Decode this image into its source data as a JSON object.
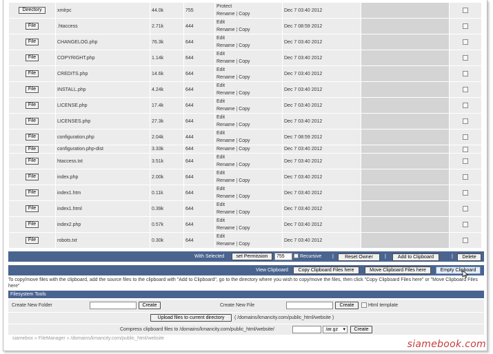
{
  "files": [
    {
      "type": "Directory",
      "name": "xmlrpc",
      "size": "44.0k",
      "perm": "755",
      "actions": [
        "Protect"
      ],
      "actions2": [
        "Rename",
        "Copy"
      ],
      "date": "Dec 7 03:40 2012"
    },
    {
      "type": "File",
      "name": ".htaccess",
      "size": "2.71k",
      "perm": "444",
      "actions": [
        "Edit"
      ],
      "actions2": [
        "Rename",
        "Copy"
      ],
      "date": "Dec 7 08:59 2012"
    },
    {
      "type": "File",
      "name": "CHANGELOG.php",
      "size": "76.3k",
      "perm": "644",
      "actions": [
        "Edit"
      ],
      "actions2": [
        "Rename",
        "Copy"
      ],
      "date": "Dec 7 03:40 2012"
    },
    {
      "type": "File",
      "name": "COPYRIGHT.php",
      "size": "1.14k",
      "perm": "644",
      "actions": [
        "Edit"
      ],
      "actions2": [
        "Rename",
        "Copy"
      ],
      "date": "Dec 7 03:40 2012"
    },
    {
      "type": "File",
      "name": "CREDITS.php",
      "size": "14.6k",
      "perm": "644",
      "actions": [
        "Edit"
      ],
      "actions2": [
        "Rename",
        "Copy"
      ],
      "date": "Dec 7 03:40 2012"
    },
    {
      "type": "File",
      "name": "INSTALL.php",
      "size": "4.24k",
      "perm": "644",
      "actions": [
        "Edit"
      ],
      "actions2": [
        "Rename",
        "Copy"
      ],
      "date": "Dec 7 03:40 2012"
    },
    {
      "type": "File",
      "name": "LICENSE.php",
      "size": "17.4k",
      "perm": "644",
      "actions": [
        "Edit"
      ],
      "actions2": [
        "Rename",
        "Copy"
      ],
      "date": "Dec 7 03:40 2012"
    },
    {
      "type": "File",
      "name": "LICENSES.php",
      "size": "27.3k",
      "perm": "644",
      "actions": [
        "Edit"
      ],
      "actions2": [
        "Rename",
        "Copy"
      ],
      "date": "Dec 7 03:40 2012"
    },
    {
      "type": "File",
      "name": "configuration.php",
      "size": "2.04k",
      "perm": "444",
      "actions": [
        "Edit"
      ],
      "actions2": [
        "Rename",
        "Copy"
      ],
      "date": "Dec 7 08:59 2012"
    },
    {
      "type": "File",
      "name": "configuration.php-dist",
      "size": "3.33k",
      "perm": "644",
      "actions": [],
      "actions2": [
        "Rename",
        "Copy"
      ],
      "date": "Dec 7 03:40 2012"
    },
    {
      "type": "File",
      "name": "htaccess.txt",
      "size": "3.51k",
      "perm": "644",
      "actions": [
        "Edit"
      ],
      "actions2": [
        "Rename",
        "Copy"
      ],
      "date": "Dec 7 03:40 2012"
    },
    {
      "type": "File",
      "name": "index.php",
      "size": "2.00k",
      "perm": "644",
      "actions": [
        "Edit"
      ],
      "actions2": [
        "Rename",
        "Copy"
      ],
      "date": "Dec 7 03:40 2012"
    },
    {
      "type": "File",
      "name": "index1.htm",
      "size": "0.11k",
      "perm": "644",
      "actions": [
        "Edit"
      ],
      "actions2": [
        "Rename",
        "Copy"
      ],
      "date": "Dec 7 03:40 2012"
    },
    {
      "type": "File",
      "name": "index1.html",
      "size": "0.39k",
      "perm": "644",
      "actions": [
        "Edit"
      ],
      "actions2": [
        "Rename",
        "Copy"
      ],
      "date": "Dec 7 03:40 2012"
    },
    {
      "type": "File",
      "name": "index2.php",
      "size": "0.57k",
      "perm": "644",
      "actions": [
        "Edit"
      ],
      "actions2": [
        "Rename",
        "Copy"
      ],
      "date": "Dec 7 03:40 2012"
    },
    {
      "type": "File",
      "name": "robots.txt",
      "size": "0.30k",
      "perm": "644",
      "actions": [
        "Edit"
      ],
      "actions2": [
        "Rename",
        "Copy"
      ],
      "date": "Dec 7 03:40 2012"
    }
  ],
  "with_selected": {
    "label": "With Selected",
    "set_permission": "set Permission",
    "permission_value": "755",
    "recursive": "Recursive",
    "reset_owner": "Reset Owner",
    "add_to_clipboard": "Add to Clipboard",
    "delete": "Delete",
    "pipe": "|"
  },
  "clipboard": {
    "view": "View Clipboard",
    "copy_here": "Copy Clipboard Files here",
    "move_here": "Move Clipboard Files here",
    "empty": "Empty Clipboard"
  },
  "help_text": "To copy/move files with the clipboard, add the source files to the clipboard with \"Add to Clipboard\", go to the directory where you wish to copy/move the files, then click \"Copy Clipboard Files here\" or \"Move Clipboard Files here\"",
  "filesystem_tools": {
    "title": "Filesystem Tools",
    "new_folder_label": "Create New Folder",
    "new_folder_button": "Create",
    "new_file_label": "Create New File",
    "new_file_button": "Create",
    "html_template": "Html template",
    "upload_button": "Upload files to current directory",
    "upload_path": "( /domains/kmancity.com/public_html/website )",
    "compress_label": "Compress clipboard files to /domains/kmancity.com/public_html/website/",
    "compress_ext": ".tar.gz",
    "compress_button": "Create"
  },
  "breadcrumb": "siamebox » FileManager » /domains/kmancity.com/public_html/website",
  "watermark": "siamebook.com",
  "colors": {
    "bar": "#4a6490",
    "row": "#ececec",
    "gray_col": "#d4d4d4"
  }
}
